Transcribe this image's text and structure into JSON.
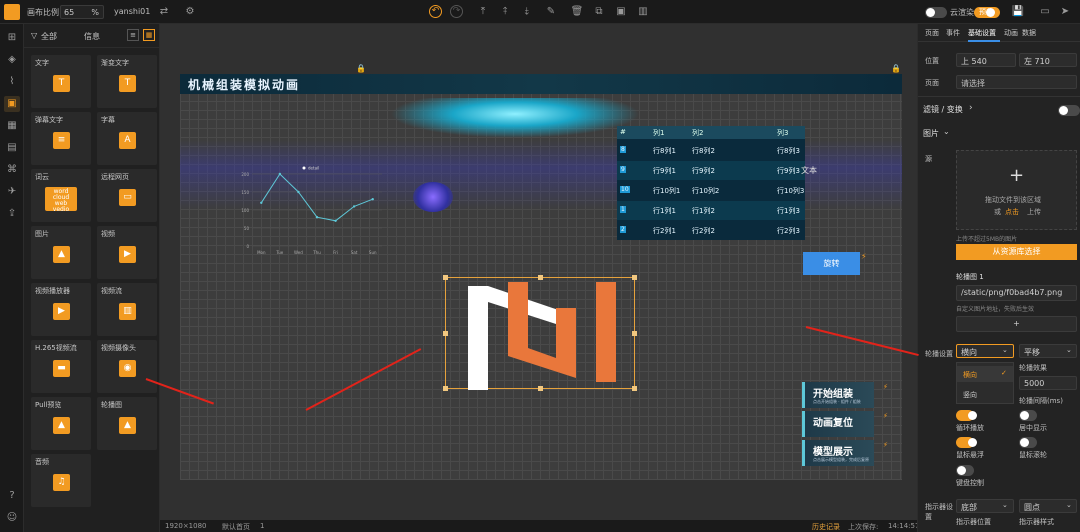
{
  "topbar": {
    "scale_label": "画布比例",
    "scale_value": "65",
    "scale_unit": "%",
    "project": "yanshi01",
    "cloud_render": "云渲染",
    "preview": "预览"
  },
  "palette": {
    "filter_all": "全部",
    "filter_info": "信息",
    "tiles": [
      "文字",
      "渐变文字",
      "弹幕文字",
      "字幕",
      "词云",
      "远程网页",
      "图片",
      "视频",
      "视频播放器",
      "视频流",
      "H.265视频流",
      "视频摄像头",
      "Pull预览",
      "轮播图",
      "音频"
    ],
    "wordcloud": [
      "word",
      "cloud",
      "web",
      "vedio"
    ]
  },
  "canvas": {
    "title": "机械组装模拟动画",
    "float_text": "文本",
    "button_rotate": "旋转",
    "menu": [
      {
        "label": "开始组装",
        "sub": "点击开始组装 · 组件 / 组装"
      },
      {
        "label": "动画复位",
        "sub": ""
      },
      {
        "label": "模型展示",
        "sub": "点击展示模型组装，完成后复原"
      }
    ],
    "table": {
      "headers": [
        "#",
        "列1",
        "列2",
        "列3"
      ],
      "rows": [
        [
          "8",
          "行8列1",
          "行8列2",
          "行8列3"
        ],
        [
          "9",
          "行9列1",
          "行9列2",
          "行9列3"
        ],
        [
          "10",
          "行10列1",
          "行10列2",
          "行10列3"
        ],
        [
          "1",
          "行1列1",
          "行1列2",
          "行1列3"
        ],
        [
          "2",
          "行2列1",
          "行2列2",
          "行2列3"
        ]
      ]
    }
  },
  "chart_data": {
    "type": "line",
    "categories": [
      "Mon",
      "Tue",
      "Wed",
      "Thu",
      "Fri",
      "Sat",
      "Sun"
    ],
    "series": [
      {
        "name": "detail",
        "values": [
          120,
          200,
          150,
          80,
          70,
          110,
          130
        ]
      }
    ],
    "ylim": [
      0,
      200
    ],
    "yticks": [
      0,
      50,
      100,
      150,
      200
    ],
    "color": "#5ec8d8"
  },
  "status": {
    "size": "1920×1080",
    "layer": "默认首页",
    "count": "1",
    "history": "历史记录",
    "saved": "上次保存:",
    "time": "14:14:57"
  },
  "props": {
    "tabs": [
      "页面",
      "事件",
      "基础设置",
      "动画",
      "数据"
    ],
    "pos_label": "位置",
    "top": "上 540",
    "left": "左 710",
    "page_label": "页面",
    "page_value": "请选择",
    "filter_label": "滤镜 / 变换",
    "image_label": "图片",
    "source_label": "源",
    "upload_hint": "拖动文件到该区域",
    "upload_or": "或",
    "upload_click": "点击",
    "upload_up": "上传",
    "upload_limit": "上传不超过5MB的图片",
    "from_lib": "从资源库选择",
    "carousel_label": "轮播图 1",
    "carousel_path": "/static/png/f0bad4b7.png",
    "carousel_hint": "自定义图片地址，失败后生效",
    "add": "+",
    "direction_label": "轮播设置",
    "direction_value": "横向",
    "opt1": "横向",
    "opt2": "竖向",
    "effect_value": "平移",
    "effect_label": "轮播效果",
    "interval_value": "5000",
    "interval_label": "轮播间隔(ms)",
    "loop": "循环播放",
    "center": "居中显示",
    "autoplay": "鼠标悬浮",
    "wheel": "鼠标滚轮",
    "keyboard": "键盘控制",
    "indicator_label": "指示器设置",
    "indicator_pos": "底部",
    "indicator_pos_label": "指示器位置",
    "indicator_style": "圆点",
    "indicator_style_label": "指示器样式"
  }
}
